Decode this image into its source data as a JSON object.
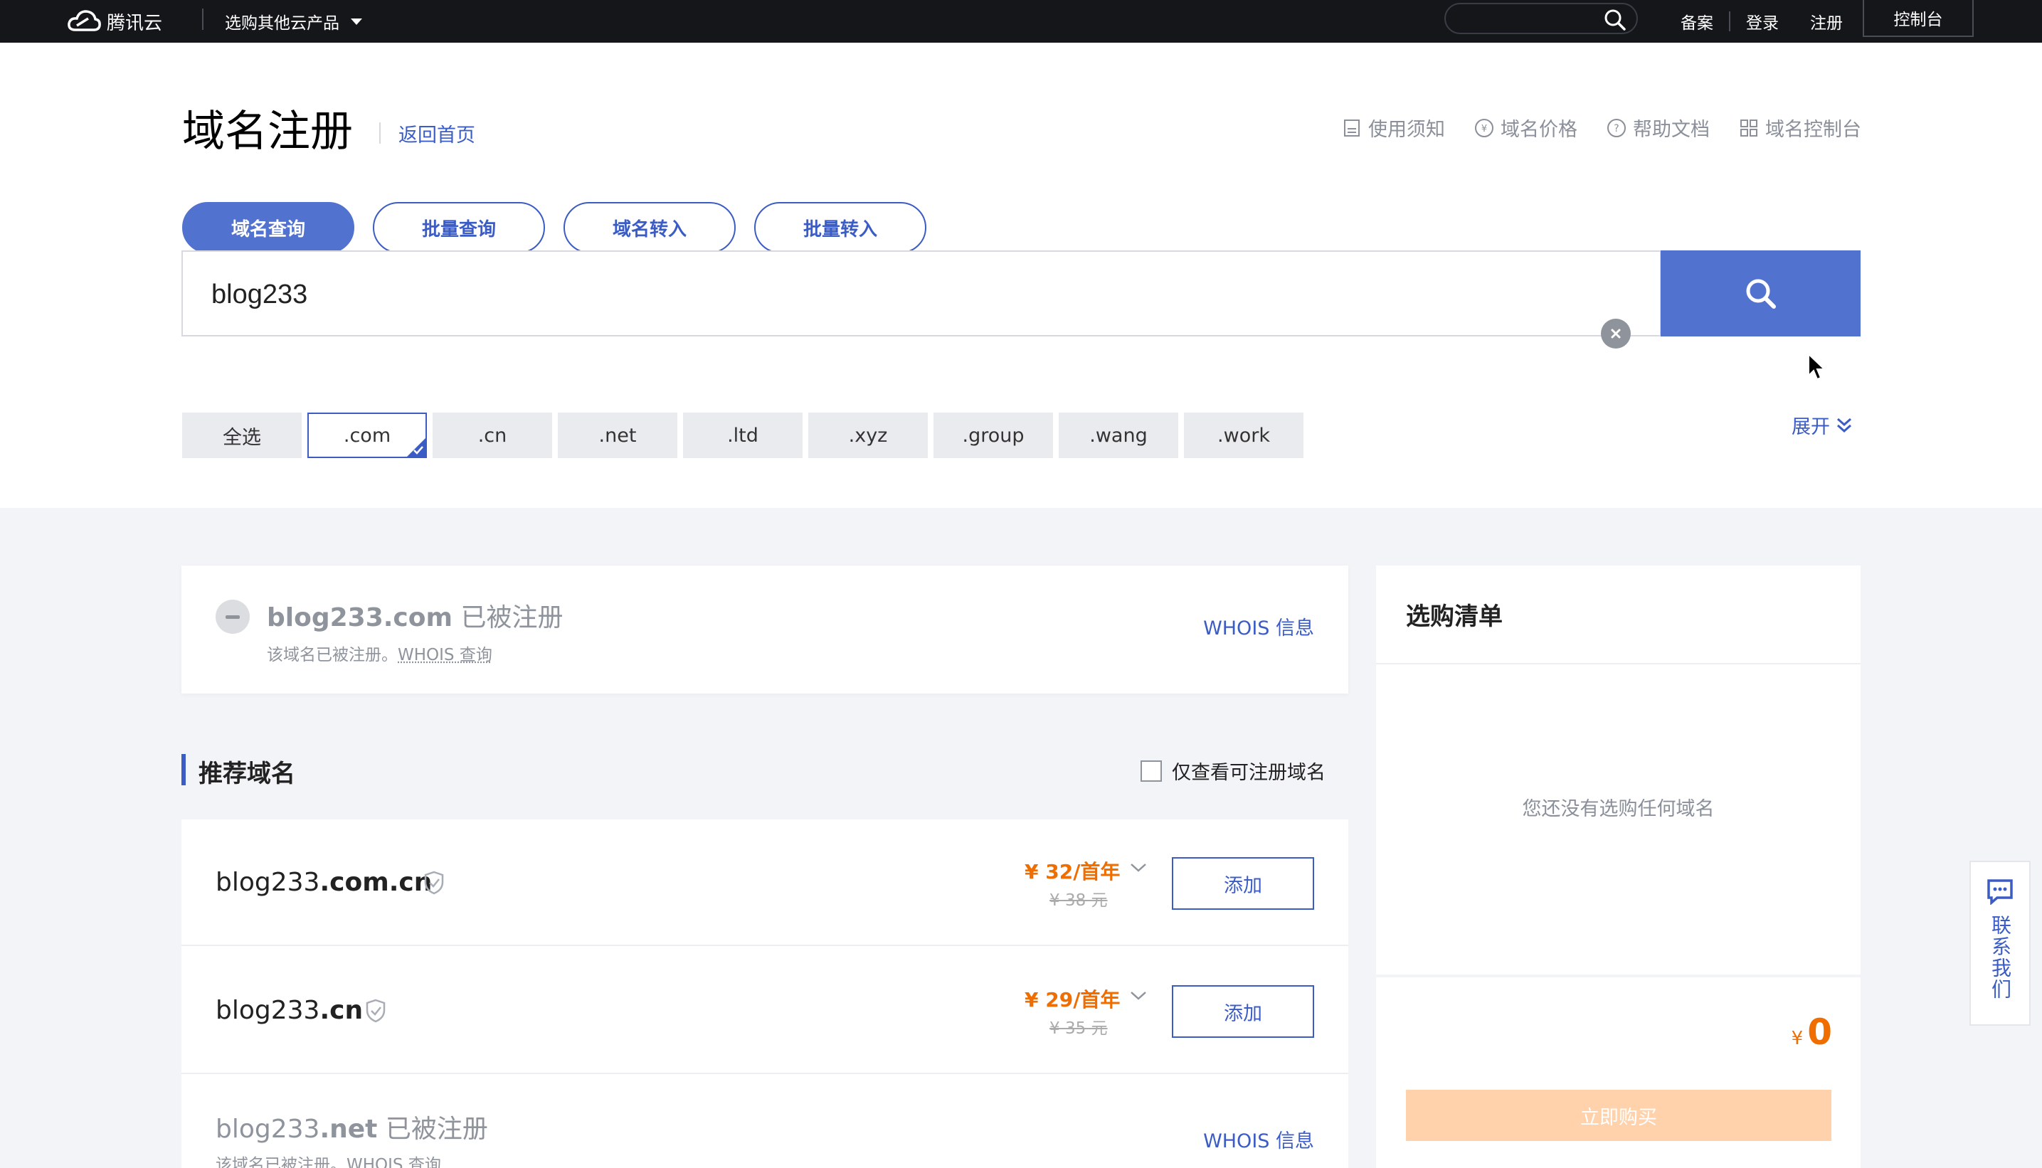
{
  "topbar": {
    "brand": "腾讯云",
    "products_menu": "选购其他云产品",
    "search_placeholder": "",
    "links": [
      "备案",
      "登录",
      "注册"
    ],
    "console": "控制台"
  },
  "header": {
    "title": "域名注册",
    "back_home": "返回首页",
    "util_links": [
      "使用须知",
      "域名价格",
      "帮助文档",
      "域名控制台"
    ]
  },
  "tabs": [
    "域名查询",
    "批量查询",
    "域名转入",
    "批量转入"
  ],
  "search": {
    "value": "blog233"
  },
  "tlds": [
    "全选",
    ".com",
    ".cn",
    ".net",
    ".ltd",
    ".xyz",
    ".group",
    ".wang",
    ".work"
  ],
  "expand_label": "展开",
  "result": {
    "domain": "blog233.com",
    "status": "已被注册",
    "sub_prefix": "该域名已被注册。",
    "sub_link": "WHOIS 查询",
    "whois": "WHOIS 信息"
  },
  "recommend": {
    "title": "推荐域名",
    "only_available": "仅查看可注册域名",
    "rows": [
      {
        "prefix": "blog233",
        "suffix": ".com.cn",
        "price": "¥ 32/首年",
        "original": "¥ 38 元",
        "action": "添加"
      },
      {
        "prefix": "blog233",
        "suffix": ".cn",
        "price": "¥ 29/首年",
        "original": "¥ 35 元",
        "action": "添加"
      }
    ],
    "taken_row": {
      "prefix": "blog233",
      "suffix": ".net",
      "status": "已被注册",
      "sub": "该域名已被注册。WHOIS 查询",
      "whois": "WHOIS 信息"
    }
  },
  "cart": {
    "title": "选购清单",
    "empty": "您还没有选购任何域名",
    "currency": "¥",
    "total": "0",
    "buy": "立即购买"
  },
  "contact": {
    "label": "联系我们"
  },
  "colors": {
    "accent": "#3b5cc4",
    "primary_button": "#5272d0",
    "price": "#f06d00",
    "buy_disabled": "#ffd2ac"
  }
}
